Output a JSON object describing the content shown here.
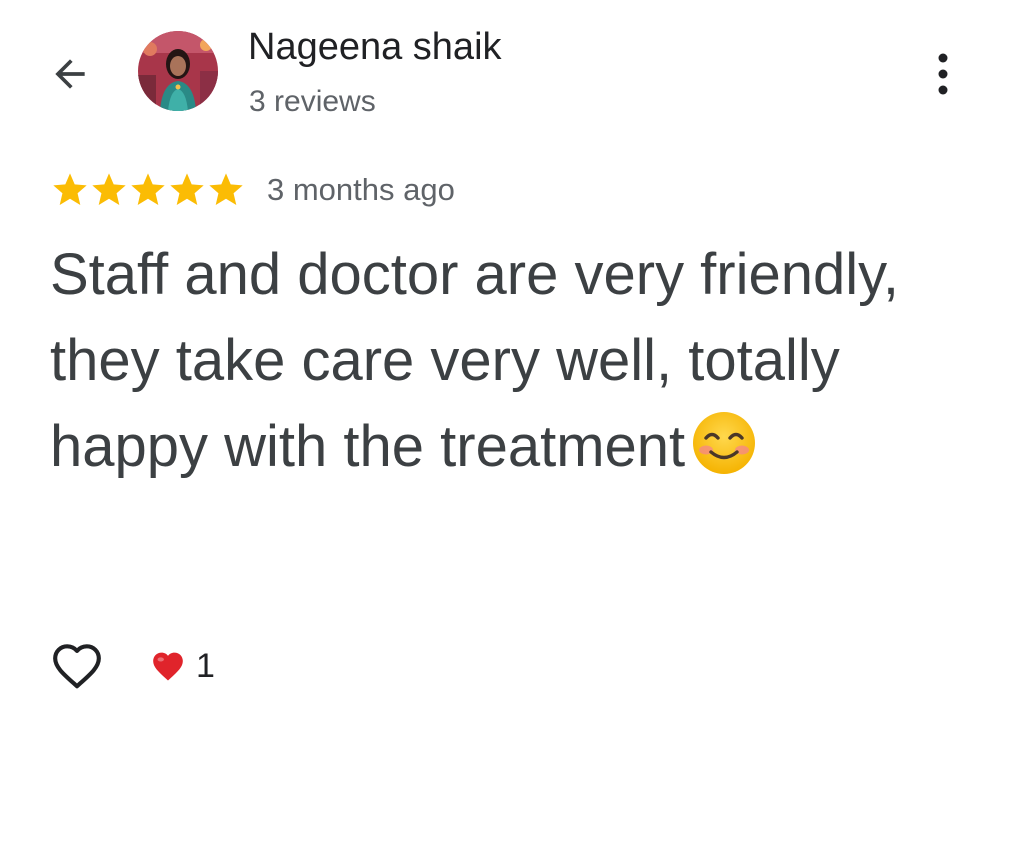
{
  "header": {
    "back_icon": "arrow-back-icon",
    "more_icon": "more-vert-icon",
    "author": {
      "name": "Nageena shaik",
      "meta": "3 reviews",
      "avatar_icon": "profile-photo"
    }
  },
  "review": {
    "rating": 5,
    "rating_max": 5,
    "star_color": "#fbbc04",
    "date": "3 months ago",
    "text": "Staff and doctor are very friendly, they take care very well, totally happy with the treatment",
    "emoji_icon": "smiling-face-icon"
  },
  "actions": {
    "like_icon": "heart-outline-icon",
    "reaction_icon": "red-heart-icon",
    "reaction_count": "1",
    "reaction_color": "#e0242b"
  }
}
